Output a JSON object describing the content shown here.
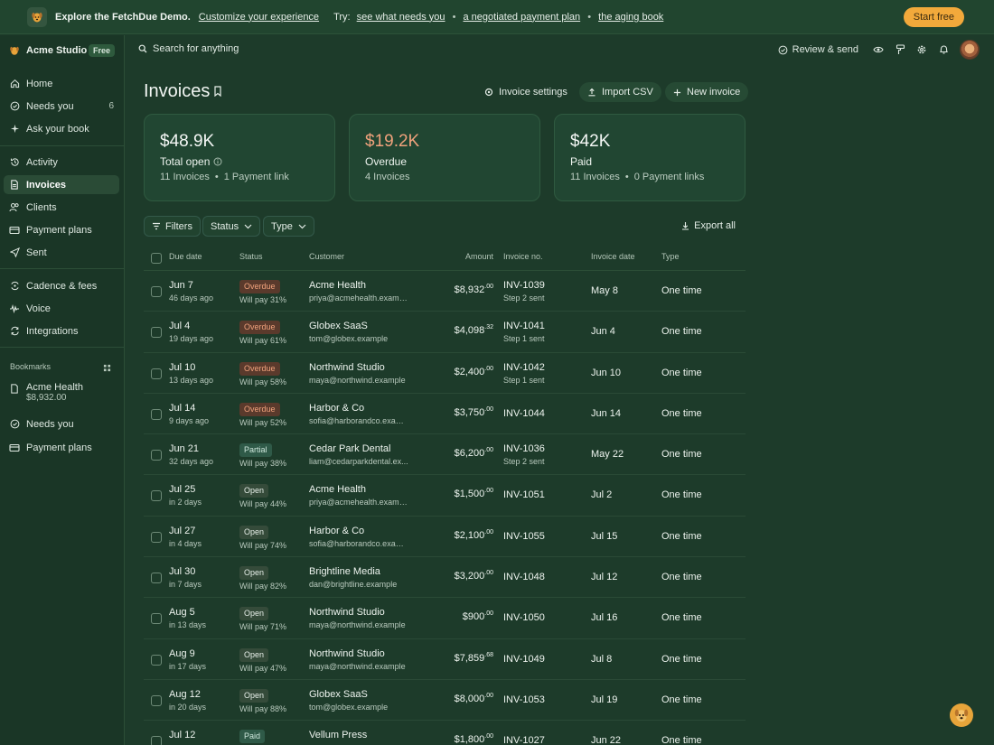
{
  "banner": {
    "title": "Explore the FetchDue Demo.",
    "customize_link": "Customize your experience",
    "try_label": "Try:",
    "try_links": [
      "see what needs you",
      "a negotiated payment plan",
      "the aging book"
    ],
    "separator": "•",
    "start_button": "Start free"
  },
  "sidebar": {
    "workspace": "Acme Studio",
    "plan_badge": "Free",
    "nav_group1": [
      {
        "label": "Home",
        "icon": "home-icon"
      },
      {
        "label": "Needs you",
        "icon": "check-circle-icon",
        "count": "6"
      },
      {
        "label": "Ask your book",
        "icon": "sparkle-icon"
      }
    ],
    "nav_group2": [
      {
        "label": "Activity",
        "icon": "history-icon"
      },
      {
        "label": "Invoices",
        "icon": "document-icon",
        "active": true
      },
      {
        "label": "Clients",
        "icon": "users-icon"
      },
      {
        "label": "Payment plans",
        "icon": "card-icon"
      },
      {
        "label": "Sent",
        "icon": "send-icon"
      }
    ],
    "nav_group3": [
      {
        "label": "Cadence & fees",
        "icon": "cadence-icon"
      },
      {
        "label": "Voice",
        "icon": "voice-icon"
      },
      {
        "label": "Integrations",
        "icon": "sync-icon"
      }
    ],
    "bookmarks_title": "Bookmarks",
    "bookmarks": [
      {
        "label": "Acme Health",
        "sub": "$8,932.00",
        "icon": "document-icon"
      },
      {
        "label": "Needs you",
        "icon": "check-circle-icon"
      },
      {
        "label": "Payment plans",
        "icon": "card-icon"
      }
    ]
  },
  "topbar": {
    "search_placeholder": "Search for anything",
    "review_label": "Review & send"
  },
  "page": {
    "title": "Invoices",
    "buttons": {
      "settings": "Invoice settings",
      "import": "Import CSV",
      "new": "New invoice"
    }
  },
  "summary": [
    {
      "amount": "$48.9K",
      "label": "Total open",
      "sub1": "11 Invoices",
      "sub2": "1 Payment link"
    },
    {
      "amount": "$19.2K",
      "label": "Overdue",
      "sub1": "4 Invoices"
    },
    {
      "amount": "$42K",
      "label": "Paid",
      "sub1": "11 Invoices",
      "sub2": "0 Payment links"
    }
  ],
  "filters": {
    "filters": "Filters",
    "status": "Status",
    "type": "Type",
    "export": "Export all"
  },
  "table": {
    "headers": {
      "due": "Due date",
      "status": "Status",
      "customer": "Customer",
      "amount": "Amount",
      "invoice": "Invoice no.",
      "date": "Invoice date",
      "type": "Type"
    },
    "rows": [
      {
        "due": "Jun 7",
        "due_sub": "46 days ago",
        "status": "Overdue",
        "pay": "Will pay 31%",
        "customer": "Acme Health",
        "email": "priya@acmehealth.examp...",
        "amount": "$8,932",
        "cents": ".00",
        "inv": "INV-1039",
        "step": "Step 2 sent",
        "date": "May 8",
        "type": "One time"
      },
      {
        "due": "Jul 4",
        "due_sub": "19 days ago",
        "status": "Overdue",
        "pay": "Will pay 61%",
        "customer": "Globex SaaS",
        "email": "tom@globex.example",
        "amount": "$4,098",
        "cents": ".32",
        "inv": "INV-1041",
        "step": "Step 1 sent",
        "date": "Jun 4",
        "type": "One time"
      },
      {
        "due": "Jul 10",
        "due_sub": "13 days ago",
        "status": "Overdue",
        "pay": "Will pay 58%",
        "customer": "Northwind Studio",
        "email": "maya@northwind.example",
        "amount": "$2,400",
        "cents": ".00",
        "inv": "INV-1042",
        "step": "Step 1 sent",
        "date": "Jun 10",
        "type": "One time"
      },
      {
        "due": "Jul 14",
        "due_sub": "9 days ago",
        "status": "Overdue",
        "pay": "Will pay 52%",
        "customer": "Harbor & Co",
        "email": "sofia@harborandco.exam...",
        "amount": "$3,750",
        "cents": ".00",
        "inv": "INV-1044",
        "step": "",
        "date": "Jun 14",
        "type": "One time"
      },
      {
        "due": "Jun 21",
        "due_sub": "32 days ago",
        "status": "Partial",
        "pay": "Will pay 38%",
        "customer": "Cedar Park Dental",
        "email": "liam@cedarparkdental.ex...",
        "amount": "$6,200",
        "cents": ".00",
        "inv": "INV-1036",
        "step": "Step 2 sent",
        "date": "May 22",
        "type": "One time"
      },
      {
        "due": "Jul 25",
        "due_sub": "in 2 days",
        "status": "Open",
        "pay": "Will pay 44%",
        "customer": "Acme Health",
        "email": "priya@acmehealth.examp...",
        "amount": "$1,500",
        "cents": ".00",
        "inv": "INV-1051",
        "step": "",
        "date": "Jul 2",
        "type": "One time"
      },
      {
        "due": "Jul 27",
        "due_sub": "in 4 days",
        "status": "Open",
        "pay": "Will pay 74%",
        "customer": "Harbor & Co",
        "email": "sofia@harborandco.exam...",
        "amount": "$2,100",
        "cents": ".00",
        "inv": "INV-1055",
        "step": "",
        "date": "Jul 15",
        "type": "One time"
      },
      {
        "due": "Jul 30",
        "due_sub": "in 7 days",
        "status": "Open",
        "pay": "Will pay 82%",
        "customer": "Brightline Media",
        "email": "dan@brightline.example",
        "amount": "$3,200",
        "cents": ".00",
        "inv": "INV-1048",
        "step": "",
        "date": "Jul 12",
        "type": "One time"
      },
      {
        "due": "Aug 5",
        "due_sub": "in 13 days",
        "status": "Open",
        "pay": "Will pay 71%",
        "customer": "Northwind Studio",
        "email": "maya@northwind.example",
        "amount": "$900",
        "cents": ".00",
        "inv": "INV-1050",
        "step": "",
        "date": "Jul 16",
        "type": "One time"
      },
      {
        "due": "Aug 9",
        "due_sub": "in 17 days",
        "status": "Open",
        "pay": "Will pay 47%",
        "customer": "Northwind Studio",
        "email": "maya@northwind.example",
        "amount": "$7,859",
        "cents": ".68",
        "inv": "INV-1049",
        "step": "",
        "date": "Jul 8",
        "type": "One time"
      },
      {
        "due": "Aug 12",
        "due_sub": "in 20 days",
        "status": "Open",
        "pay": "Will pay 88%",
        "customer": "Globex SaaS",
        "email": "tom@globex.example",
        "amount": "$8,000",
        "cents": ".00",
        "inv": "INV-1053",
        "step": "",
        "date": "Jul 19",
        "type": "One time"
      },
      {
        "due": "Jul 12",
        "due_sub": "",
        "status": "Paid",
        "pay": "",
        "customer": "Vellum Press",
        "email": "",
        "amount": "$1,800",
        "cents": ".00",
        "inv": "INV-1027",
        "step": "",
        "date": "Jun 22",
        "type": "One time"
      }
    ]
  }
}
